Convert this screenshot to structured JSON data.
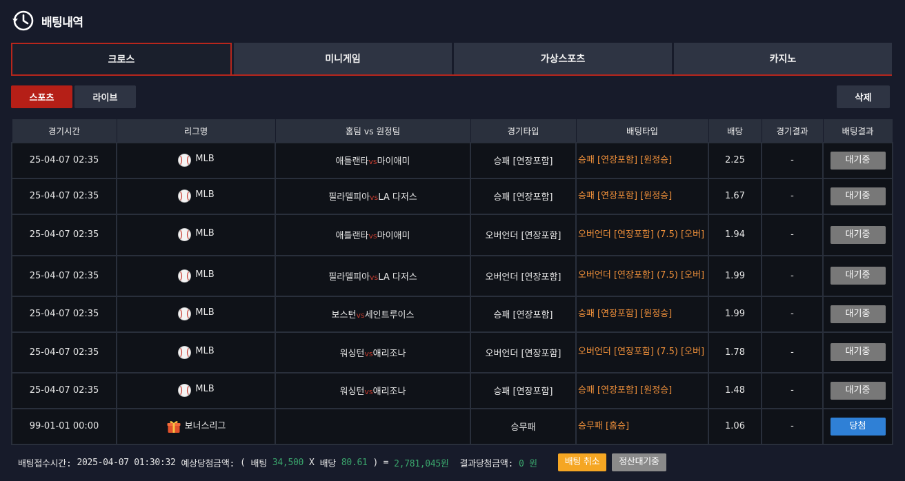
{
  "header": {
    "title": "배팅내역",
    "icon": "history-clock-icon"
  },
  "tabs": [
    {
      "label": "크로스",
      "active": true
    },
    {
      "label": "미니게임",
      "active": false
    },
    {
      "label": "가상스포츠",
      "active": false
    },
    {
      "label": "카지노",
      "active": false
    }
  ],
  "subtabs": [
    {
      "label": "스포츠",
      "active": true
    },
    {
      "label": "라이브",
      "active": false
    }
  ],
  "delete_label": "삭제",
  "table": {
    "columns": [
      "경기시간",
      "리그명",
      "홈팀 vs 원정팀",
      "경기타입",
      "배팅타입",
      "배당",
      "경기결과",
      "배팅결과"
    ],
    "vs_label": "vs",
    "rows": [
      {
        "time": "25-04-07 02:35",
        "league": "MLB",
        "league_icon": "baseball-icon",
        "home": "애틀랜타",
        "away": "마이애미",
        "game_type": "승패 [연장포함]",
        "bet_type": "승패 [연장포함] [원정승]",
        "odds": "2.25",
        "result": "-",
        "status": "대기중"
      },
      {
        "time": "25-04-07 02:35",
        "league": "MLB",
        "league_icon": "baseball-icon",
        "home": "필라델피아",
        "away": "LA 다저스",
        "game_type": "승패 [연장포함]",
        "bet_type": "승패 [연장포함] [원정승]",
        "odds": "1.67",
        "result": "-",
        "status": "대기중"
      },
      {
        "time": "25-04-07 02:35",
        "league": "MLB",
        "league_icon": "baseball-icon",
        "home": "애틀랜타",
        "away": "마이애미",
        "game_type": "오버언더 [연장포함]",
        "bet_type": "오버언더 [연장포함] (7.5) [오버]",
        "odds": "1.94",
        "result": "-",
        "status": "대기중"
      },
      {
        "time": "25-04-07 02:35",
        "league": "MLB",
        "league_icon": "baseball-icon",
        "home": "필라델피아",
        "away": "LA 다저스",
        "game_type": "오버언더 [연장포함]",
        "bet_type": "오버언더 [연장포함] (7.5) [오버]",
        "odds": "1.99",
        "result": "-",
        "status": "대기중"
      },
      {
        "time": "25-04-07 02:35",
        "league": "MLB",
        "league_icon": "baseball-icon",
        "home": "보스턴",
        "away": "세인트루이스",
        "game_type": "승패 [연장포함]",
        "bet_type": "승패 [연장포함] [원정승]",
        "odds": "1.99",
        "result": "-",
        "status": "대기중"
      },
      {
        "time": "25-04-07 02:35",
        "league": "MLB",
        "league_icon": "baseball-icon",
        "home": "워싱턴",
        "away": "애리조나",
        "game_type": "오버언더 [연장포함]",
        "bet_type": "오버언더 [연장포함] (7.5) [오버]",
        "odds": "1.78",
        "result": "-",
        "status": "대기중"
      },
      {
        "time": "25-04-07 02:35",
        "league": "MLB",
        "league_icon": "baseball-icon",
        "home": "워싱턴",
        "away": "애리조나",
        "game_type": "승패 [연장포함]",
        "bet_type": "승패 [연장포함] [원정승]",
        "odds": "1.48",
        "result": "-",
        "status": "대기중"
      },
      {
        "time": "99-01-01 00:00",
        "league": "보너스리그",
        "league_icon": "gift-icon",
        "home": "",
        "away": "",
        "game_type": "승무패",
        "bet_type": "승무패 [홈승]",
        "odds": "1.06",
        "result": "-",
        "status": "당첨",
        "status_win": true
      }
    ]
  },
  "footer": {
    "received_label": "배팅접수시간:",
    "received_time": "2025-04-07 01:30:32",
    "expected_label": "예상당첨금액:",
    "open_paren": "(",
    "bet_label": "배팅",
    "bet_amount": "34,500",
    "times": "X",
    "odds_label": "배당",
    "total_odds": "80.61",
    "close_eq": ") =",
    "expected_amount": "2,781,045원",
    "result_label": "결과당첨금액:",
    "result_amount": "0 원",
    "cancel_label": "배팅 취소",
    "pending_label": "정산대기중"
  },
  "colors": {
    "background": "#171b2a",
    "accent_red": "#b51f17",
    "bet_type_orange": "#f0903a",
    "win_blue": "#2f80d6",
    "pending_gray": "#787878",
    "cancel_orange": "#f5a623",
    "amount_green": "#3aa56c"
  }
}
